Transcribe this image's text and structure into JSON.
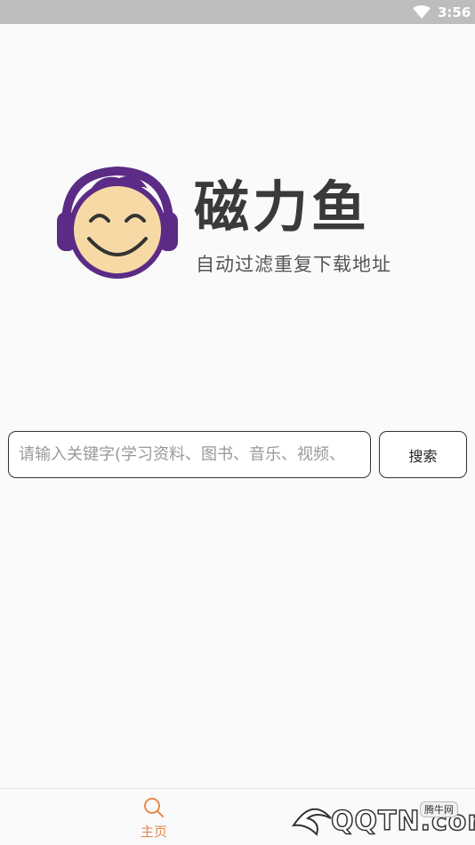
{
  "status_bar": {
    "time": "3:56",
    "wifi_icon": "wifi-icon"
  },
  "brand": {
    "logo_icon": "smiling-face-headphones-icon",
    "title": "磁力鱼",
    "slogan": "自动过滤重复下载地址"
  },
  "search": {
    "placeholder": "请输入关键字(学习资料、图书、音乐、视频、",
    "value": "",
    "button_label": "搜索"
  },
  "bottom_nav": {
    "items": [
      {
        "label": "主页",
        "icon": "search-icon",
        "active": true,
        "color": "#e58a4e"
      }
    ]
  },
  "watermark": {
    "text": "QQTN.com",
    "sub": "腾牛网"
  },
  "colors": {
    "accent": "#e58a4e",
    "logo_purple": "#5b2b86",
    "face": "#f7d9a6"
  }
}
